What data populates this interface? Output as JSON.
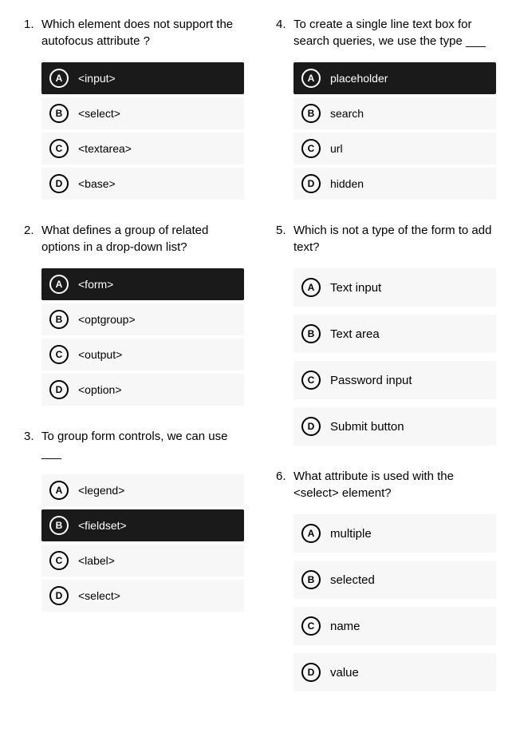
{
  "columns": [
    [
      {
        "number": "1.",
        "text": "Which element does not support the autofocus attribute ?",
        "spacious": false,
        "options": [
          {
            "letter": "A",
            "text": "<input>",
            "selected": true
          },
          {
            "letter": "B",
            "text": "<select>",
            "selected": false
          },
          {
            "letter": "C",
            "text": "<textarea>",
            "selected": false
          },
          {
            "letter": "D",
            "text": "<base>",
            "selected": false
          }
        ]
      },
      {
        "number": "2.",
        "text": "What defines a group of related options in a drop-down list?",
        "spacious": false,
        "options": [
          {
            "letter": "A",
            "text": "<form>",
            "selected": true
          },
          {
            "letter": "B",
            "text": "<optgroup>",
            "selected": false
          },
          {
            "letter": "C",
            "text": "<output>",
            "selected": false
          },
          {
            "letter": "D",
            "text": "<option>",
            "selected": false
          }
        ]
      },
      {
        "number": "3.",
        "text": "To group form controls, we can use ___",
        "spacious": false,
        "options": [
          {
            "letter": "A",
            "text": "<legend>",
            "selected": false
          },
          {
            "letter": "B",
            "text": "<fieldset>",
            "selected": true
          },
          {
            "letter": "C",
            "text": "<label>",
            "selected": false
          },
          {
            "letter": "D",
            "text": "<select>",
            "selected": false
          }
        ]
      }
    ],
    [
      {
        "number": "4.",
        "text": "To create a single line text box for search queries, we use the type ___",
        "spacious": false,
        "options": [
          {
            "letter": "A",
            "text": "placeholder",
            "selected": true
          },
          {
            "letter": "B",
            "text": "search",
            "selected": false
          },
          {
            "letter": "C",
            "text": "url",
            "selected": false
          },
          {
            "letter": "D",
            "text": "hidden",
            "selected": false
          }
        ]
      },
      {
        "number": "5.",
        "text": "Which is not a type of the form to add text?",
        "spacious": true,
        "options": [
          {
            "letter": "A",
            "text": "Text input",
            "selected": false
          },
          {
            "letter": "B",
            "text": "Text area",
            "selected": false
          },
          {
            "letter": "C",
            "text": "Password input",
            "selected": false
          },
          {
            "letter": "D",
            "text": "Submit button",
            "selected": false
          }
        ]
      },
      {
        "number": "6.",
        "text": "What attribute is used with the <select> element?",
        "spacious": true,
        "options": [
          {
            "letter": "A",
            "text": "multiple",
            "selected": false
          },
          {
            "letter": "B",
            "text": "selected",
            "selected": false
          },
          {
            "letter": "C",
            "text": "name",
            "selected": false
          },
          {
            "letter": "D",
            "text": "value",
            "selected": false
          }
        ]
      }
    ]
  ]
}
